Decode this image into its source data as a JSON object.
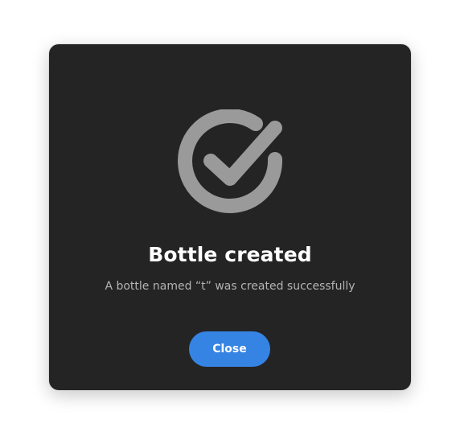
{
  "dialog": {
    "icon": "check-circle-icon",
    "title": "Bottle created",
    "subtitle": "A bottle named “t” was created successfully",
    "close_label": "Close"
  },
  "colors": {
    "dialog_background": "#242424",
    "icon": "#9a9a9a",
    "title": "#ffffff",
    "subtitle": "#b3b3b3",
    "accent": "#3584e4"
  }
}
